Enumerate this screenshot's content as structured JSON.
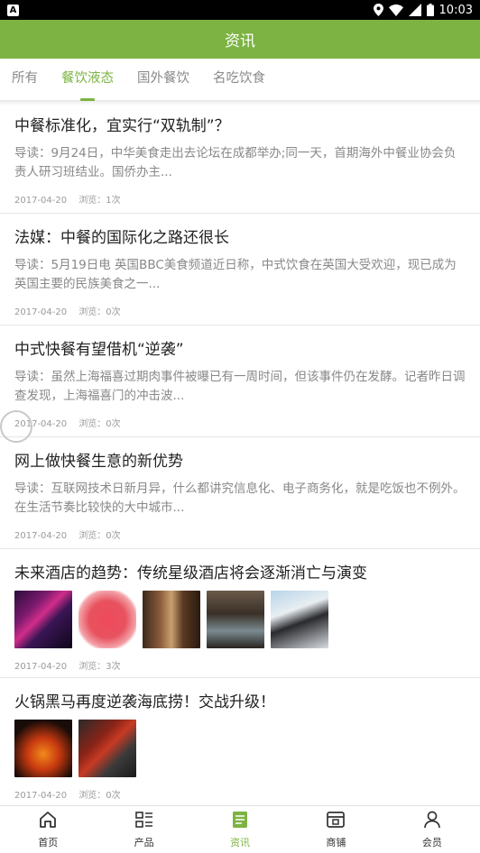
{
  "status": {
    "time": "10:03",
    "app_letter": "A"
  },
  "header": {
    "title": "资讯"
  },
  "tabs": [
    {
      "label": "所有"
    },
    {
      "label": "餐饮液态"
    },
    {
      "label": "国外餐饮"
    },
    {
      "label": "名吃饮食"
    }
  ],
  "articles": [
    {
      "title": "中餐标准化，宜实行“双轨制”？",
      "summary": "导读：9月24日，中华美食走出去论坛在成都举办;同一天，首期海外中餐业协会负责人研习班结业。国侨办主...",
      "date": "2017-04-20",
      "views": "浏览：1次"
    },
    {
      "title": "法媒：中餐的国际化之路还很长",
      "summary": "导读：5月19日电 英国BBC美食频道近日称，中式饮食在英国大受欢迎，现已成为英国主要的民族美食之一...",
      "date": "2017-04-20",
      "views": "浏览：0次"
    },
    {
      "title": "中式快餐有望借机“逆袭”",
      "summary": "导读：虽然上海福喜过期肉事件被曝已有一周时间，但该事件仍在发酵。记者昨日调查发现，上海福喜门的冲击波...",
      "date": "2017-04-20",
      "views": "浏览：0次"
    },
    {
      "title": "网上做快餐生意的新优势",
      "summary": "导读：互联网技术日新月异，什么都讲究信息化、电子商务化，就是吃饭也不例外。在生活节奏比较快的大中城市...",
      "date": "2017-04-20",
      "views": "浏览：0次"
    },
    {
      "title": "未来酒店的趋势：传统星级酒店将会逐渐消亡与演变",
      "date": "2017-04-20",
      "views": "浏览：3次"
    },
    {
      "title": "火锅黑马再度逆袭海底捞！交战升级！",
      "date": "2017-04-20",
      "views": "浏览：0次"
    }
  ],
  "nav": [
    {
      "label": "首页",
      "icon": "home-icon"
    },
    {
      "label": "产品",
      "icon": "list-icon"
    },
    {
      "label": "资讯",
      "icon": "news-icon"
    },
    {
      "label": "商铺",
      "icon": "store-icon"
    },
    {
      "label": "会员",
      "icon": "user-icon"
    }
  ],
  "colors": {
    "accent": "#7cb342"
  }
}
